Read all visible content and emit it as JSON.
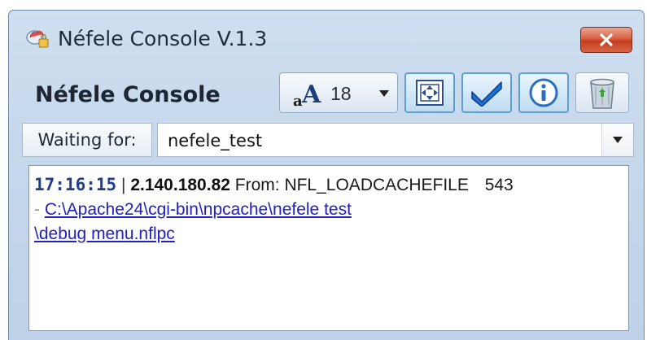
{
  "window": {
    "title": "Néfele Console V.1.3",
    "close_label": "✕"
  },
  "toolbar": {
    "console_title": "Néfele Console",
    "font_size": "18",
    "buttons": [
      {
        "name": "fit-window-icon"
      },
      {
        "name": "checkmark-icon"
      },
      {
        "name": "info-icon"
      },
      {
        "name": "trash-icon"
      }
    ]
  },
  "filter": {
    "label": "Waiting for:",
    "value": "nefele_test"
  },
  "log": {
    "time": "17:16:15",
    "separator": "|",
    "ip": "2.140.180.82",
    "from": "From: NFL_LOADCACHEFILE",
    "count": "543",
    "dash": "-",
    "path_part1": "C:\\Apache24\\cgi-bin\\npcache\\nefele test",
    "path_part2": "\\debug menu.nflpc"
  },
  "colors": {
    "accent": "#5fa0d0",
    "close_red": "#c63d1d",
    "link": "#2020c8",
    "time": "#1f3f8a"
  }
}
